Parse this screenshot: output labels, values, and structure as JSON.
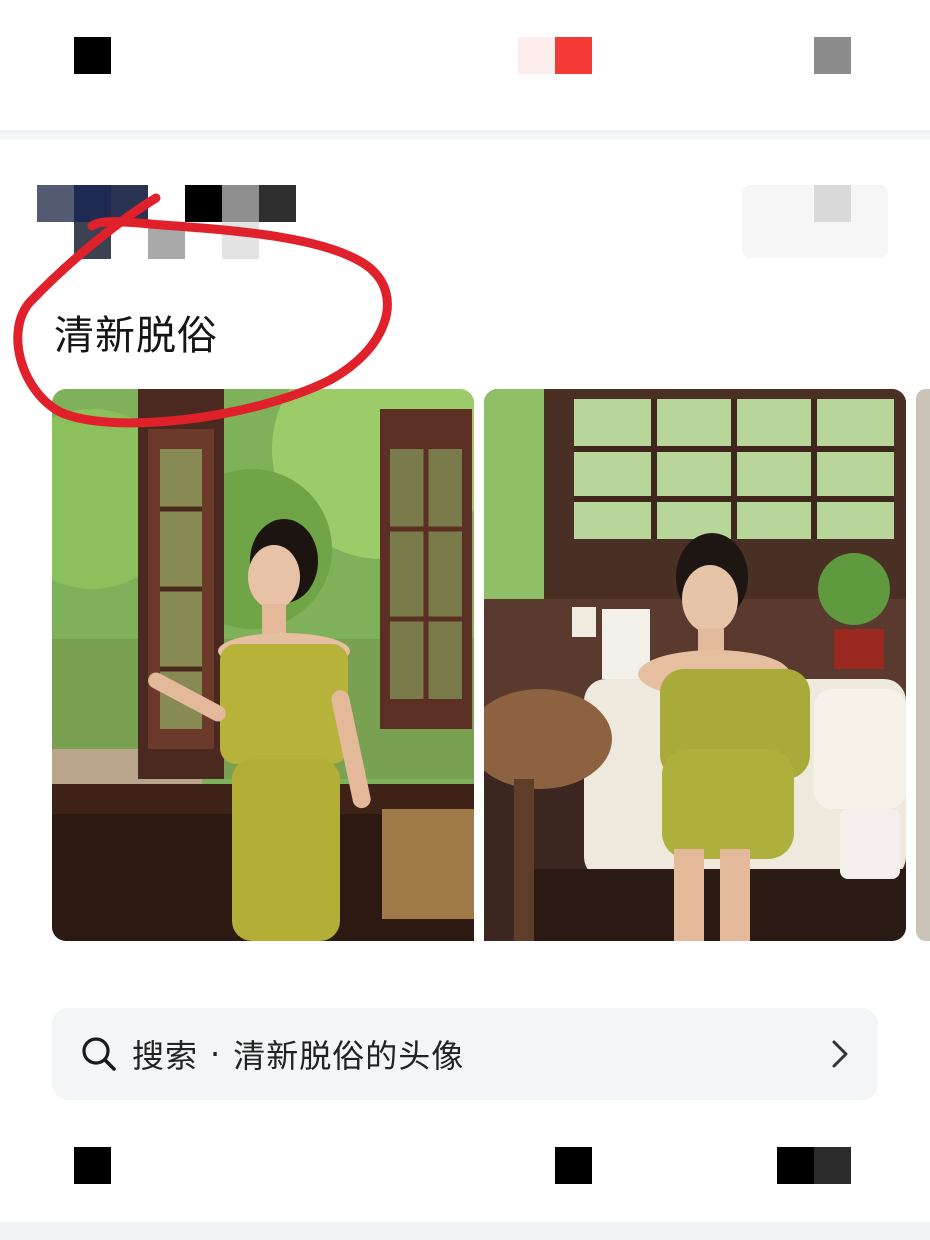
{
  "post": {
    "title": "清新脱俗"
  },
  "search": {
    "prefix": "搜索",
    "separator": "·",
    "query": "清新脱俗的头像"
  },
  "colors": {
    "annotation": "#e0202a",
    "dress": "#b7b33a",
    "search_bg": "#f4f5f7"
  },
  "icons": {
    "search": "search-icon",
    "chevron": "chevron-right-icon"
  }
}
